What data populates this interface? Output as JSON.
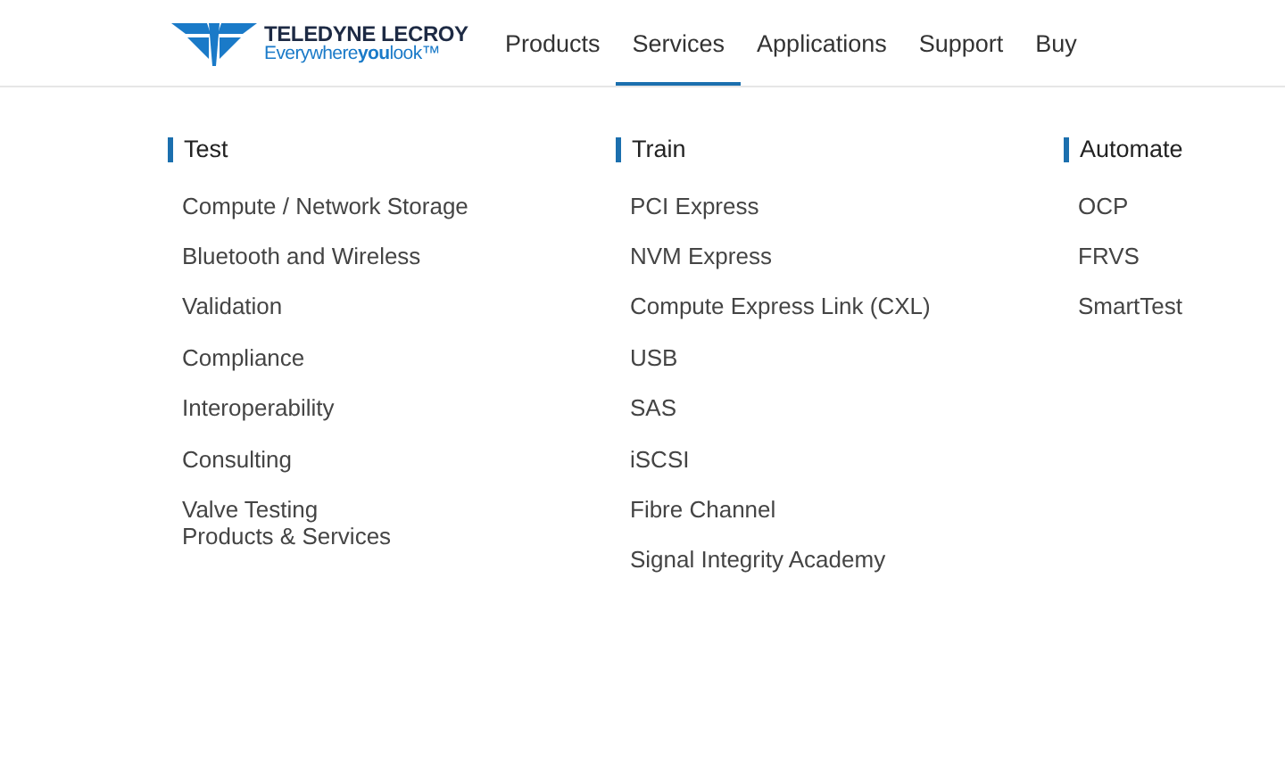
{
  "logo": {
    "name": "TELEDYNE LECROY",
    "tagline": "Everywhere**you**look™"
  },
  "nav": [
    {
      "label": "Products",
      "selected": false
    },
    {
      "label": "Services",
      "selected": true
    },
    {
      "label": "Applications",
      "selected": false
    },
    {
      "label": "Support",
      "selected": false
    },
    {
      "label": "Buy",
      "selected": false
    }
  ],
  "menu_columns": [
    {
      "heading": "Test",
      "items": [
        "Compute / Network Storage",
        "Bluetooth and Wireless",
        "Validation",
        "Compliance",
        "Interoperability",
        "Consulting",
        "Valve Testing\nProducts & Services"
      ]
    },
    {
      "heading": "Train",
      "items": [
        "PCI Express",
        "NVM Express",
        "Compute Express Link (CXL)",
        "USB",
        "SAS",
        "iSCSI",
        "Fibre Channel",
        "Signal Integrity Academy"
      ]
    },
    {
      "heading": "Automate",
      "items": [
        "OCP",
        "FRVS",
        "SmartTest"
      ]
    }
  ]
}
